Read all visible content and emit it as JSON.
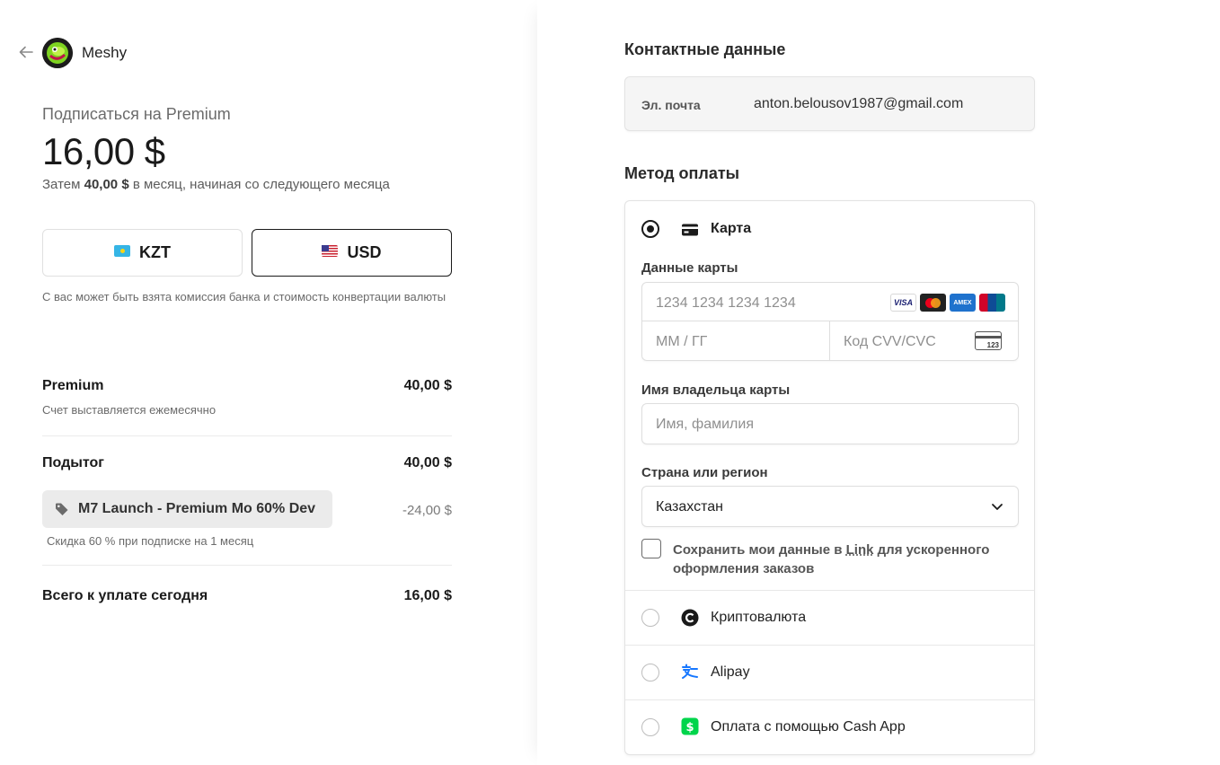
{
  "merchant": {
    "name": "Meshy"
  },
  "summary": {
    "subscribe_label": "Подписаться на Premium",
    "price": "16,00 $",
    "then_prefix": "Затем",
    "then_amount": "40,00 $",
    "then_suffix": "в месяц, начиная со следующего месяца"
  },
  "currency": {
    "options": [
      {
        "code": "KZT",
        "flag": "kz-flag",
        "selected": false
      },
      {
        "code": "USD",
        "flag": "us-flag",
        "selected": true
      }
    ],
    "note": "С вас может быть взята комиссия банка и стоимость конвертации валюты"
  },
  "line_items": {
    "premium_label": "Premium",
    "premium_value": "40,00 $",
    "premium_sub": "Счет выставляется ежемесячно",
    "subtotal_label": "Подытог",
    "subtotal_value": "40,00 $",
    "promo_code": "M7 Launch - Premium Mo 60% Dev",
    "promo_value": "-24,00 $",
    "promo_sub": "Скидка 60 % при подписке на 1 месяц",
    "total_label": "Всего к уплате сегодня",
    "total_value": "16,00 $"
  },
  "contact": {
    "heading": "Контактные данные",
    "email_label": "Эл. почта",
    "email_value": "anton.belousov1987@gmail.com"
  },
  "payment": {
    "heading": "Метод оплаты",
    "card": {
      "label": "Карта",
      "selected": true,
      "card_data_label": "Данные карты",
      "number_placeholder": "1234 1234 1234 1234",
      "expiry_placeholder": "ММ / ГГ",
      "cvc_placeholder": "Код CVV/CVC",
      "cvc_icon_text": "123",
      "brands": [
        "VISA",
        "Mastercard",
        "AMEX",
        "UnionPay"
      ],
      "holder_label": "Имя владельца карты",
      "holder_placeholder": "Имя, фамилия",
      "country_label": "Страна или регион",
      "country_value": "Казахстан",
      "save_text_before": "Сохранить мои данные в",
      "save_link": "Link",
      "save_text_after": "для ускоренного оформления заказов"
    },
    "methods": [
      {
        "label": "Криптовалюта",
        "icon": "crypto-icon"
      },
      {
        "label": "Alipay",
        "icon": "alipay-icon"
      },
      {
        "label": "Оплата с помощью Cash App",
        "icon": "cashapp-icon"
      }
    ]
  },
  "colors": {
    "cashapp": "#00d54b",
    "alipay": "#1677ff",
    "text": "#1a1a1a"
  }
}
